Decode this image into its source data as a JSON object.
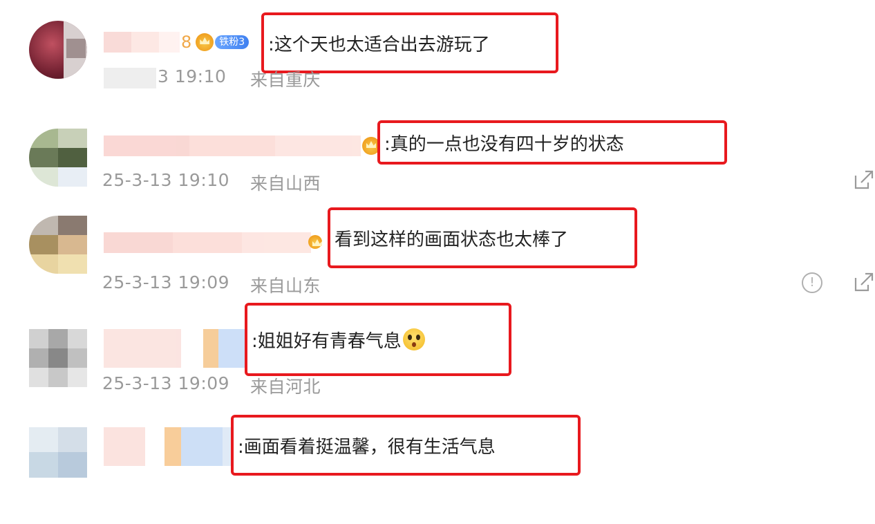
{
  "comments": [
    {
      "username_tail": "8",
      "fan_badge": "铁粉3",
      "content": ":这个天也太适合出去游玩了",
      "timestamp_partial": "3 19:10",
      "location_label": "来自重庆"
    },
    {
      "content": ":真的一点也没有四十岁的状态",
      "timestamp": "25-3-13 19:10",
      "location_label": "来自山西"
    },
    {
      "content": "看到这样的画面状态也太棒了",
      "timestamp": "25-3-13 19:09",
      "location_label": "来自山东"
    },
    {
      "content": ":姐姐好有青春气息",
      "emoji": "thinking-face-emoji",
      "timestamp": "25-3-13 19:09",
      "location_label": "来自河北"
    },
    {
      "content": ":画面看着挺温馨，很有生活气息"
    }
  ],
  "icons": {
    "share": "share-icon",
    "report": "report-icon"
  },
  "colors": {
    "highlight_border": "#e8191e",
    "meta_text": "#9a9a9a",
    "body_text": "#222222",
    "fan_badge": "#3f80f0"
  }
}
